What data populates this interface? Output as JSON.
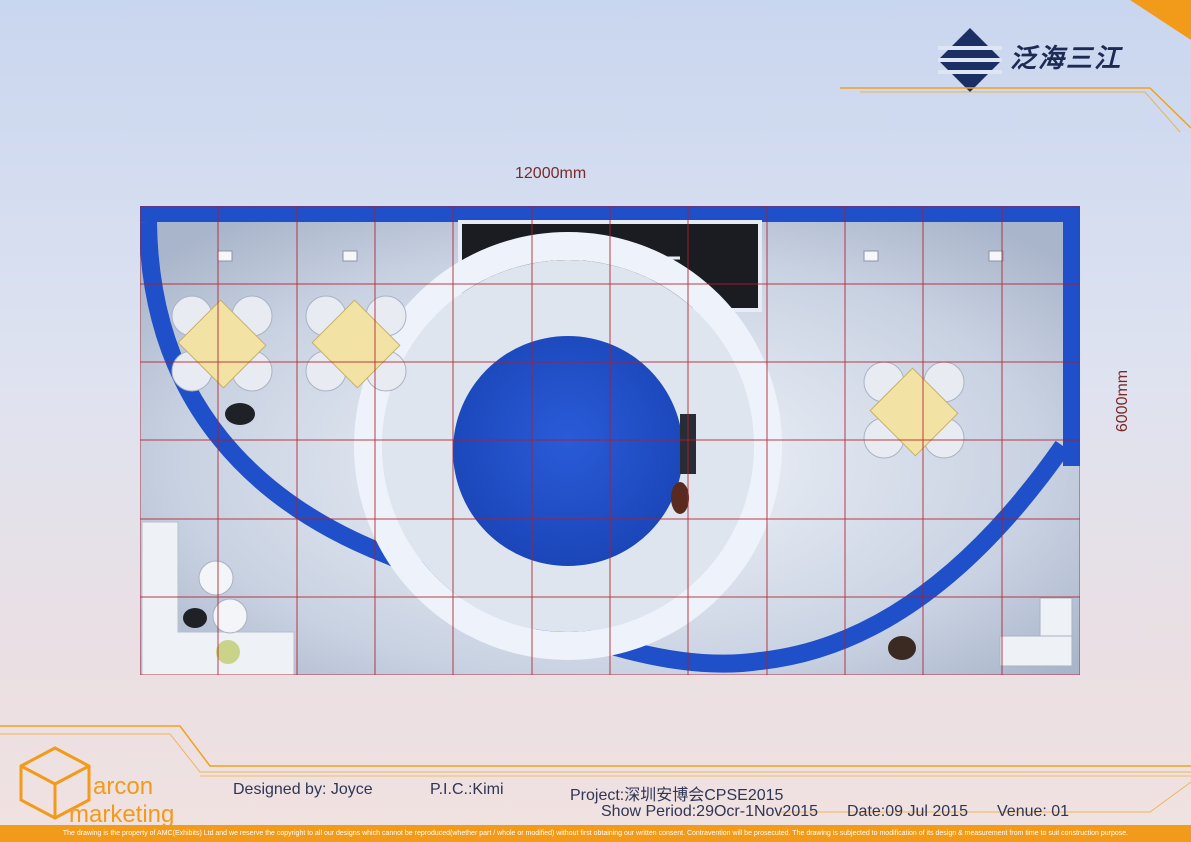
{
  "brand": {
    "name": "泛海三江",
    "accent": "#1e3a78"
  },
  "dimensions": {
    "width": "12000mm",
    "depth": "6000mm"
  },
  "company": {
    "line1": "arcon",
    "line2": "marketing",
    "accent": "#f29a1a"
  },
  "info": {
    "designed_by": "Designed by: Joyce",
    "pic": "P.I.C.:Kimi",
    "project": "Project:深圳安博会CPSE2015",
    "show_period": "Show Period:29Ocr-1Nov2015",
    "date": "Date:09 Jul 2015",
    "venue": "Venue: 01"
  },
  "disclaimer": "The drawing is the property of AMC(Exhibits) Ltd and we reserve the copyright to all our designs which cannot be reproduced(whether part / whole or modified) without first obtaining our written consent. Contravention will be prosecuted. The drawing is subjected to modification of its design & measurement from time to suit construction purpose.",
  "colors": {
    "booth_blue": "#1f4fc9",
    "grid_red": "#b21e2a",
    "gold": "#f0a21e"
  }
}
